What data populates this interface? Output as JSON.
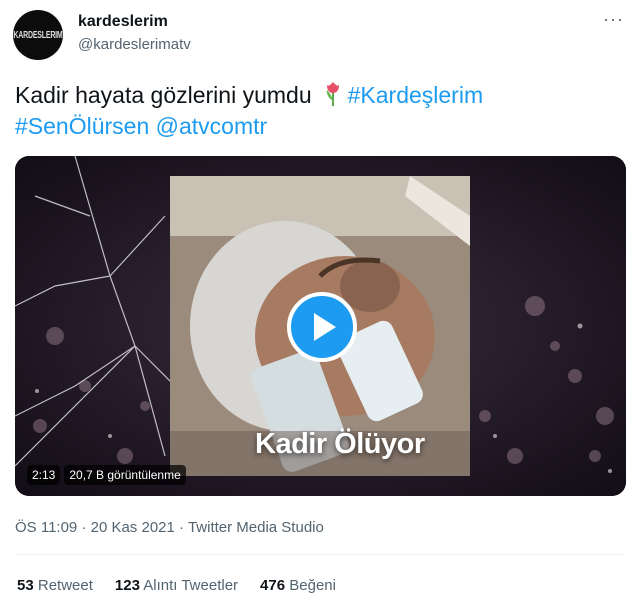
{
  "author": {
    "avatar_text": "KARDESLERIM",
    "display_name": "kardeslerim",
    "handle": "@kardeslerimatv"
  },
  "more_icon": "more-horizontal-icon",
  "tweet": {
    "text_plain": "Kadir hayata gözlerini yumdu",
    "emoji": "tulip-icon",
    "hashtag_1": "#Kardeşlerim",
    "hashtag_2": "#SenÖlürsen",
    "mention": "@atvcomtr"
  },
  "media": {
    "overlay_title": "Kadir Ölüyor",
    "duration": "2:13",
    "views": "20,7 B görüntülenme"
  },
  "meta": {
    "time": "ÖS 11:09",
    "date": "20 Kas 2021",
    "source": "Twitter Media Studio"
  },
  "stats": {
    "retweets_count": "53",
    "retweets_label": "Retweet",
    "quotes_count": "123",
    "quotes_label": "Alıntı Tweetler",
    "likes_count": "476",
    "likes_label": "Beğeni"
  },
  "colors": {
    "link": "#1d9bf0",
    "secondary_text": "#536471",
    "primary_text": "#0f1419"
  }
}
